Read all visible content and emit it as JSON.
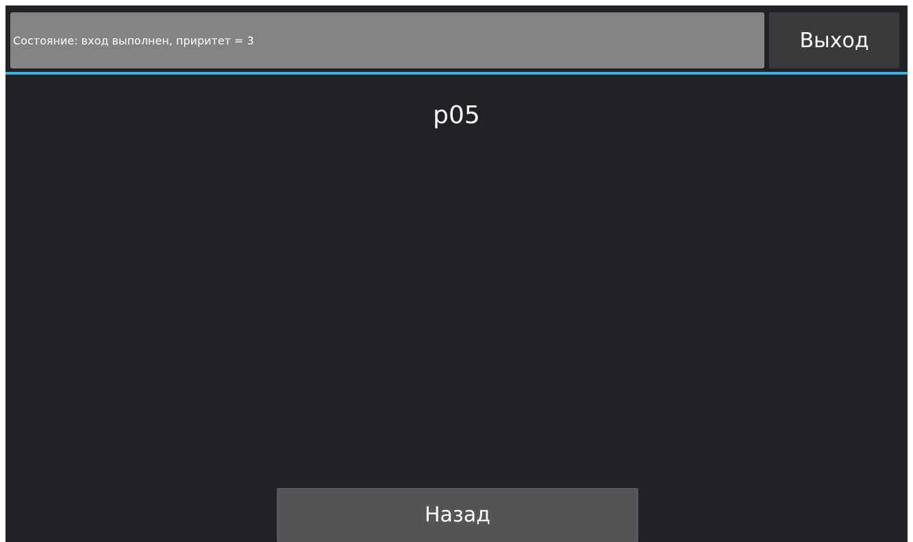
{
  "header": {
    "status_text": "Состояние: вход выполнен, приритет = 3",
    "exit_label": "Выход"
  },
  "main": {
    "title": "p05",
    "back_label": "Назад"
  },
  "colors": {
    "background": "#222226",
    "status_bar": "#838383",
    "exit_button": "#3a3a3c",
    "accent": "#33b5e5",
    "back_button": "#555557",
    "text": "#ffffff"
  }
}
